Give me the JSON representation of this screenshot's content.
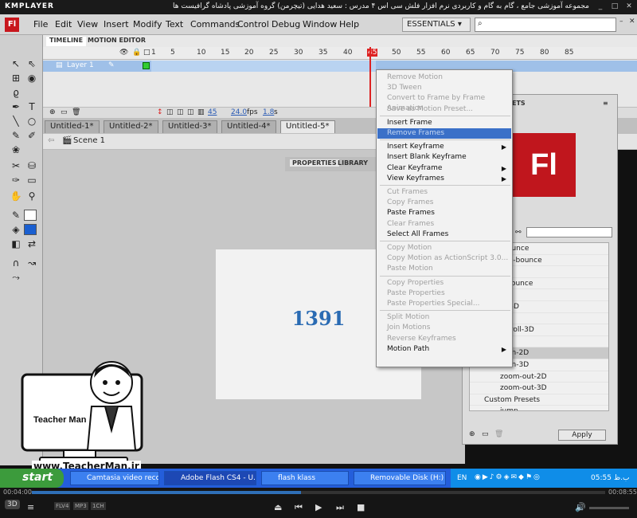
{
  "player": {
    "logo": "KMPLAYER",
    "title": "مجموعه آموزشی جامع ، گام به گام و کاربردی نرم افزار فلش سی اس ۴ مدرس : سعید هدایی (تیچرمن) گروه آموزشی پادشاه گرافیست ها",
    "time_elapsed": "00:04:00",
    "time_total": "00:08:55",
    "progress": 0.47,
    "badges": [
      "FLV4",
      "MP3",
      "1CH"
    ]
  },
  "app": {
    "menu": [
      "File",
      "Edit",
      "View",
      "Insert",
      "Modify",
      "Text",
      "Commands",
      "Control",
      "Debug",
      "Window",
      "Help"
    ],
    "workspace": "ESSENTIALS",
    "logo": "Fl"
  },
  "timeline": {
    "tabs": [
      "TIMELINE",
      "MOTION EDITOR"
    ],
    "layer_name": "Layer 1",
    "frame_numbers": [
      "1",
      "5",
      "10",
      "15",
      "20",
      "25",
      "30",
      "35",
      "40",
      "45",
      "50",
      "55",
      "60",
      "65",
      "70",
      "75",
      "80",
      "85"
    ],
    "current_frame": "45",
    "fps": "24.0",
    "fps_unit": "fps",
    "time": "1.8",
    "time_unit": "s"
  },
  "doc_tabs": [
    "Untitled-1*",
    "Untitled-2*",
    "Untitled-3*",
    "Untitled-4*",
    "Untitled-5*"
  ],
  "scene": "Scene 1",
  "stage": {
    "text": "1391"
  },
  "panels": {
    "properties": "PROPERTIES",
    "library": "LIBRARY",
    "partial": "ETS"
  },
  "context_menu": [
    {
      "label": "Remove Motion",
      "disabled": true
    },
    {
      "label": "3D Tween",
      "disabled": true
    },
    {
      "label": "Convert to Frame by Frame Animation",
      "disabled": true
    },
    {
      "label": "Save as Motion Preset...",
      "disabled": true
    },
    {
      "sep": true
    },
    {
      "label": "Insert Frame",
      "disabled": false
    },
    {
      "label": "Remove Frames",
      "disabled": false,
      "highlight": true
    },
    {
      "sep": true
    },
    {
      "label": "Insert Keyframe",
      "disabled": false,
      "submenu": true
    },
    {
      "label": "Insert Blank Keyframe",
      "disabled": false
    },
    {
      "label": "Clear Keyframe",
      "disabled": false,
      "submenu": true
    },
    {
      "label": "View Keyframes",
      "disabled": false,
      "submenu": true
    },
    {
      "sep": true
    },
    {
      "label": "Cut Frames",
      "disabled": true
    },
    {
      "label": "Copy Frames",
      "disabled": true
    },
    {
      "label": "Paste Frames",
      "disabled": false
    },
    {
      "label": "Clear Frames",
      "disabled": true
    },
    {
      "label": "Select All Frames",
      "disabled": false
    },
    {
      "sep": true
    },
    {
      "label": "Copy Motion",
      "disabled": true
    },
    {
      "label": "Copy Motion as ActionScript 3.0...",
      "disabled": true
    },
    {
      "label": "Paste Motion",
      "disabled": true
    },
    {
      "sep": true
    },
    {
      "label": "Copy Properties",
      "disabled": true
    },
    {
      "label": "Paste Properties",
      "disabled": true
    },
    {
      "label": "Paste Properties Special...",
      "disabled": true
    },
    {
      "sep": true
    },
    {
      "label": "Split Motion",
      "disabled": true
    },
    {
      "label": "Join Motions",
      "disabled": true
    },
    {
      "label": "Reverse Keyframes",
      "disabled": true
    },
    {
      "label": "Motion Path",
      "disabled": false,
      "submenu": true
    }
  ],
  "presets": [
    {
      "label": "-bounce"
    },
    {
      "label": "iple-bounce"
    },
    {
      "label": "e"
    },
    {
      "label": "ll-bounce"
    },
    {
      "label": "ke"
    },
    {
      "label": "al-3D"
    },
    {
      "label": "osh"
    },
    {
      "label": "-scroll-3D"
    },
    {
      "label": "e"
    },
    {
      "label": "m-in-2D",
      "selected": true
    },
    {
      "label": "m-in-3D"
    },
    {
      "label": "zoom-out-2D"
    },
    {
      "label": "zoom-out-3D"
    },
    {
      "label": "Custom Presets",
      "folder": true
    },
    {
      "label": "jump"
    }
  ],
  "apply_label": "Apply",
  "watermark": {
    "name": "Teacher Man",
    "url": "www.TeacherMan.ir"
  },
  "taskbar": {
    "start": "start",
    "tasks": [
      "Camtasia video reco...",
      "Adobe Flash CS4 - U...",
      "flash klass",
      "Removable Disk (H:)"
    ],
    "lang": "EN",
    "clock": "05:55 ب.ظ"
  }
}
